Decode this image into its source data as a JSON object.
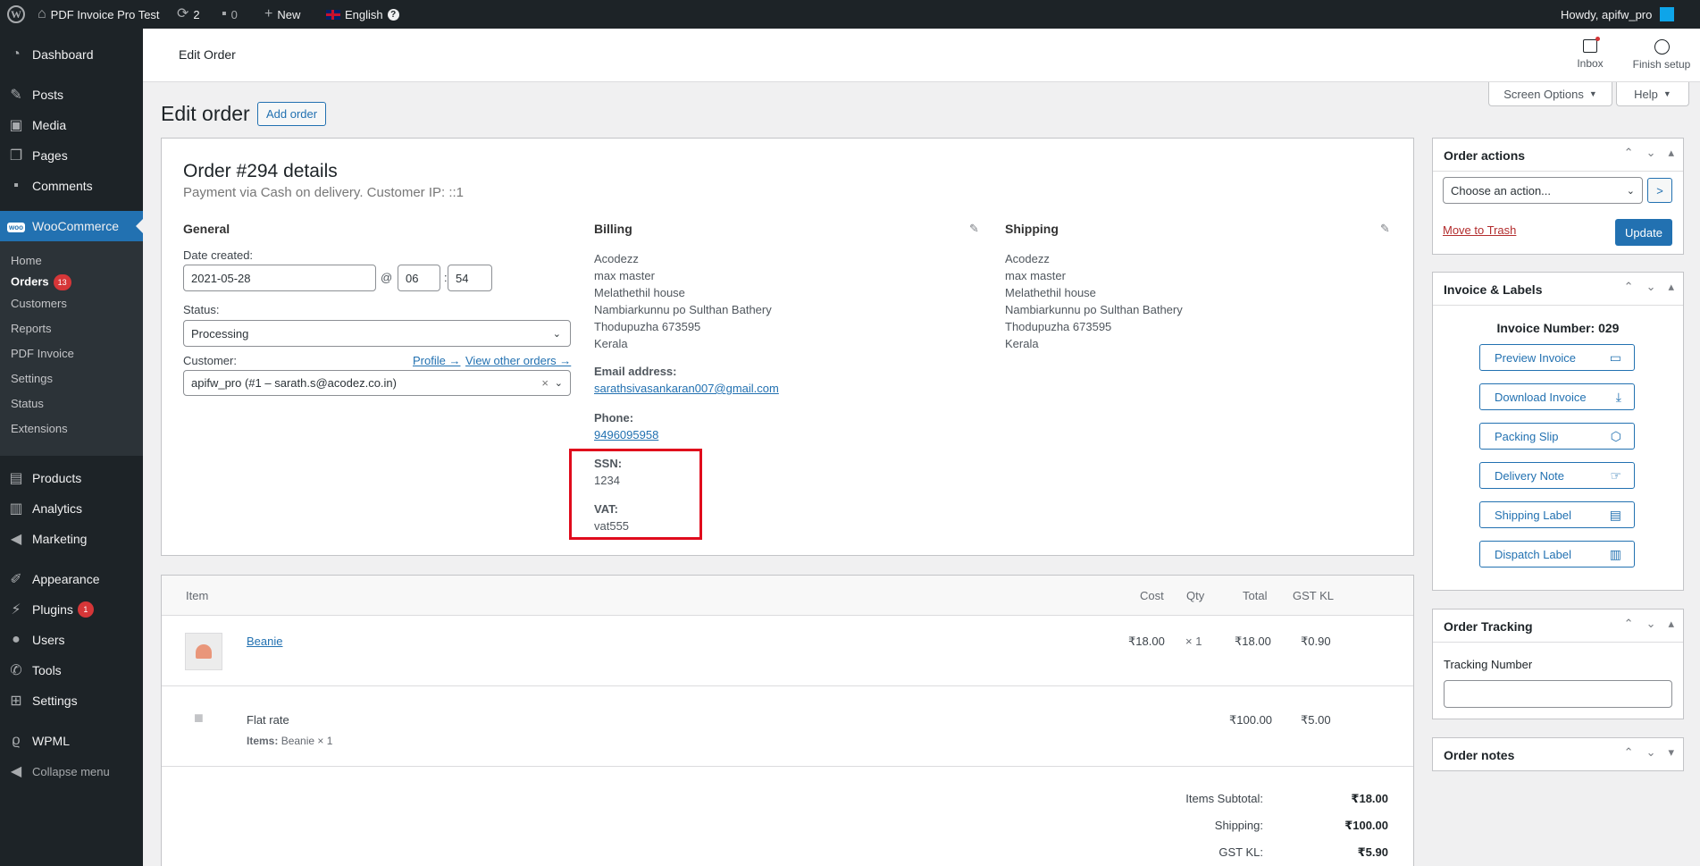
{
  "adminbar": {
    "site": "PDF Invoice Pro Test",
    "updates": "2",
    "comments": "0",
    "new": "New",
    "language": "English",
    "howdy": "Howdy, apifw_pro"
  },
  "sidebar": {
    "dashboard": "Dashboard",
    "posts": "Posts",
    "media": "Media",
    "pages": "Pages",
    "comments": "Comments",
    "woocommerce": "WooCommerce",
    "sub": [
      "Home",
      "Orders",
      "Customers",
      "Reports",
      "PDF Invoice",
      "Settings",
      "Status",
      "Extensions"
    ],
    "orders_badge": "13",
    "products": "Products",
    "analytics": "Analytics",
    "marketing": "Marketing",
    "appearance": "Appearance",
    "plugins": "Plugins",
    "plugins_badge": "1",
    "users": "Users",
    "tools": "Tools",
    "settings": "Settings",
    "wpml": "WPML",
    "collapse": "Collapse menu"
  },
  "header": {
    "title": "Edit Order",
    "inbox": "Inbox",
    "finish": "Finish setup"
  },
  "screen_options": "Screen Options",
  "help": "Help",
  "page": {
    "title": "Edit order",
    "add_order": "Add order"
  },
  "order": {
    "title": "Order #294 details",
    "subtitle": "Payment via Cash on delivery. Customer IP: ::1",
    "general": {
      "heading": "General",
      "date_label": "Date created:",
      "date": "2021-05-28",
      "at": "@",
      "hour": "06",
      "colon": ":",
      "minute": "54",
      "status_label": "Status:",
      "status": "Processing",
      "customer_label": "Customer:",
      "profile": "Profile →",
      "view_orders": "View other orders →",
      "customer": "apifw_pro (#1 – sarath.s@acodez.co.in)",
      "clear": "×"
    },
    "billing": {
      "heading": "Billing",
      "lines": [
        "Acodezz",
        "max master",
        "Melathethil house",
        "Nambiarkunnu po Sulthan Bathery",
        "Thodupuzha 673595",
        "Kerala"
      ],
      "email_label": "Email address:",
      "email": "sarathsivasankaran007@gmail.com",
      "phone_label": "Phone:",
      "phone": "9496095958",
      "ssn_label": "SSN:",
      "ssn": "1234",
      "vat_label": "VAT:",
      "vat": "vat555"
    },
    "shipping": {
      "heading": "Shipping",
      "lines": [
        "Acodezz",
        "max master",
        "Melathethil house",
        "Nambiarkunnu po Sulthan Bathery",
        "Thodupuzha 673595",
        "Kerala"
      ]
    }
  },
  "items": {
    "headers": {
      "item": "Item",
      "cost": "Cost",
      "qty": "Qty",
      "total": "Total",
      "gst": "GST KL"
    },
    "product": {
      "name": "Beanie",
      "cost": "₹18.00",
      "qty": "× 1",
      "total": "₹18.00",
      "gst": "₹0.90"
    },
    "shipping_row": {
      "name": "Flat rate",
      "items_label": "Items:",
      "items": "Beanie × 1",
      "total": "₹100.00",
      "gst": "₹5.00"
    },
    "totals": [
      {
        "label": "Items Subtotal:",
        "value": "₹18.00"
      },
      {
        "label": "Shipping:",
        "value": "₹100.00"
      },
      {
        "label": "GST KL:",
        "value": "₹5.90"
      }
    ]
  },
  "order_actions": {
    "title": "Order actions",
    "select": "Choose an action...",
    "go": ">",
    "trash": "Move to Trash",
    "update": "Update"
  },
  "invoice": {
    "title": "Invoice & Labels",
    "number": "Invoice Number: 029",
    "buttons": [
      "Preview Invoice",
      "Download Invoice",
      "Packing Slip",
      "Delivery Note",
      "Shipping Label",
      "Dispatch Label"
    ]
  },
  "tracking": {
    "title": "Order Tracking",
    "label": "Tracking Number",
    "value": ""
  },
  "notes": {
    "title": "Order notes"
  },
  "colors": {
    "highlight": "#e00b1c",
    "accent": "#2271b1"
  }
}
